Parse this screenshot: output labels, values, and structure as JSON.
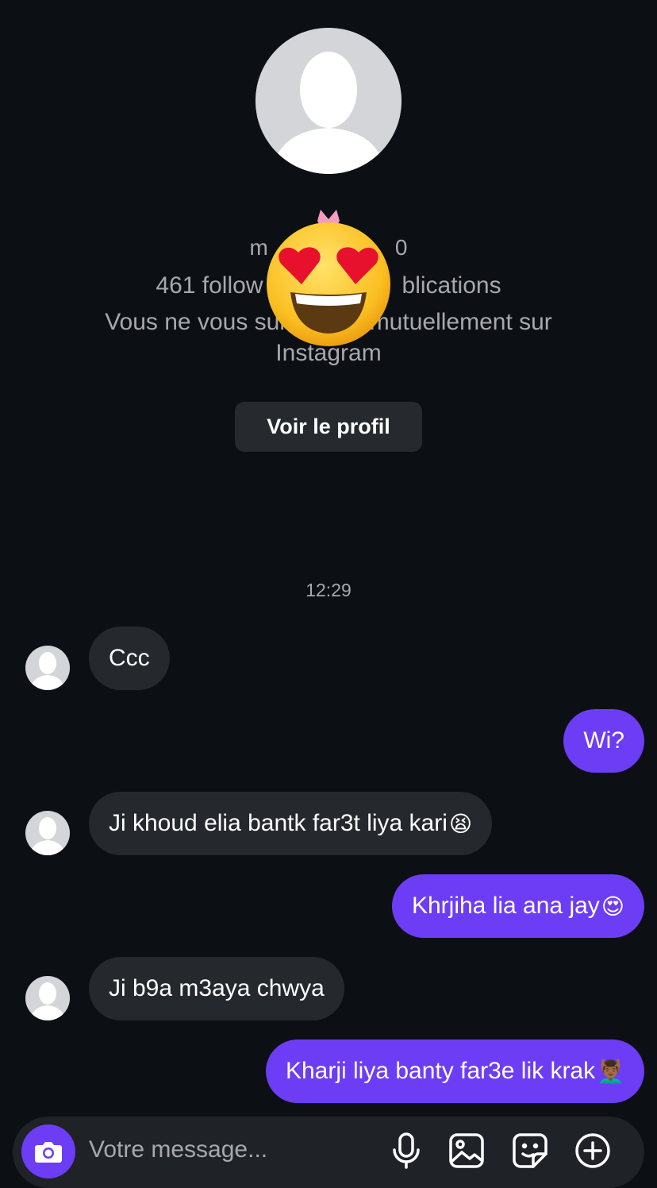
{
  "profile": {
    "username_fragment_left": "m",
    "username_fragment_right": "0",
    "stats": "461 follow                     blications",
    "mutual": "Vous ne vous suiv           mutuellement sur Instagram",
    "view_profile_label": "Voir le profil",
    "privacy_cover_emoji": "😍",
    "avatar_icon": "default-person-icon"
  },
  "thread": {
    "timestamp": "12:29",
    "messages": [
      {
        "direction": "in",
        "text": "Ccc"
      },
      {
        "direction": "out",
        "text": "Wi?"
      },
      {
        "direction": "in",
        "text": "Ji khoud elia bantk far3t liya kari",
        "emoji": "😫"
      },
      {
        "direction": "out",
        "text": "Khrjiha lia ana jay",
        "emoji": "😍"
      },
      {
        "direction": "in",
        "text": "Ji b9a m3aya chwya"
      },
      {
        "direction": "out",
        "text": "Kharji liya banty far3e lik krak",
        "emoji": "💆🏾‍♂️"
      }
    ]
  },
  "composer": {
    "placeholder": "Votre message...",
    "icons": [
      "camera-icon",
      "microphone-icon",
      "image-icon",
      "sticker-icon",
      "plus-icon"
    ]
  },
  "colors": {
    "background": "#0c1014",
    "incoming_bubble": "#25282d",
    "outgoing_bubble": "#6d3df5",
    "secondary_text": "#a8a8ad"
  }
}
